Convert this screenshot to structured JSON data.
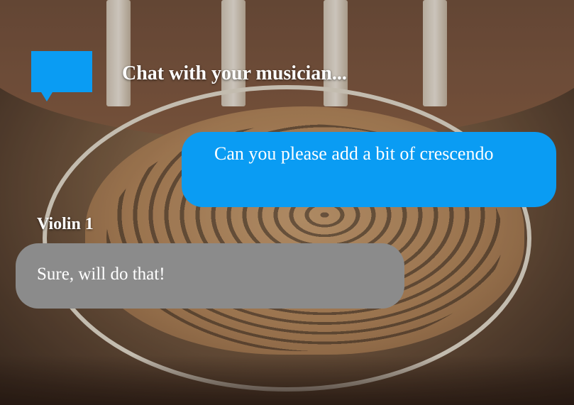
{
  "header": {
    "title": "Chat with your musician...",
    "icon": "chat-bubble-icon",
    "accent_color": "#0a9cf3"
  },
  "messages": [
    {
      "direction": "outgoing",
      "text": "Can you please add a bit of crescendo",
      "color": "#0a9cf3"
    },
    {
      "direction": "incoming",
      "sender": "Violin 1",
      "text": "Sure, will do that!",
      "color": "#8b8b8b"
    }
  ]
}
